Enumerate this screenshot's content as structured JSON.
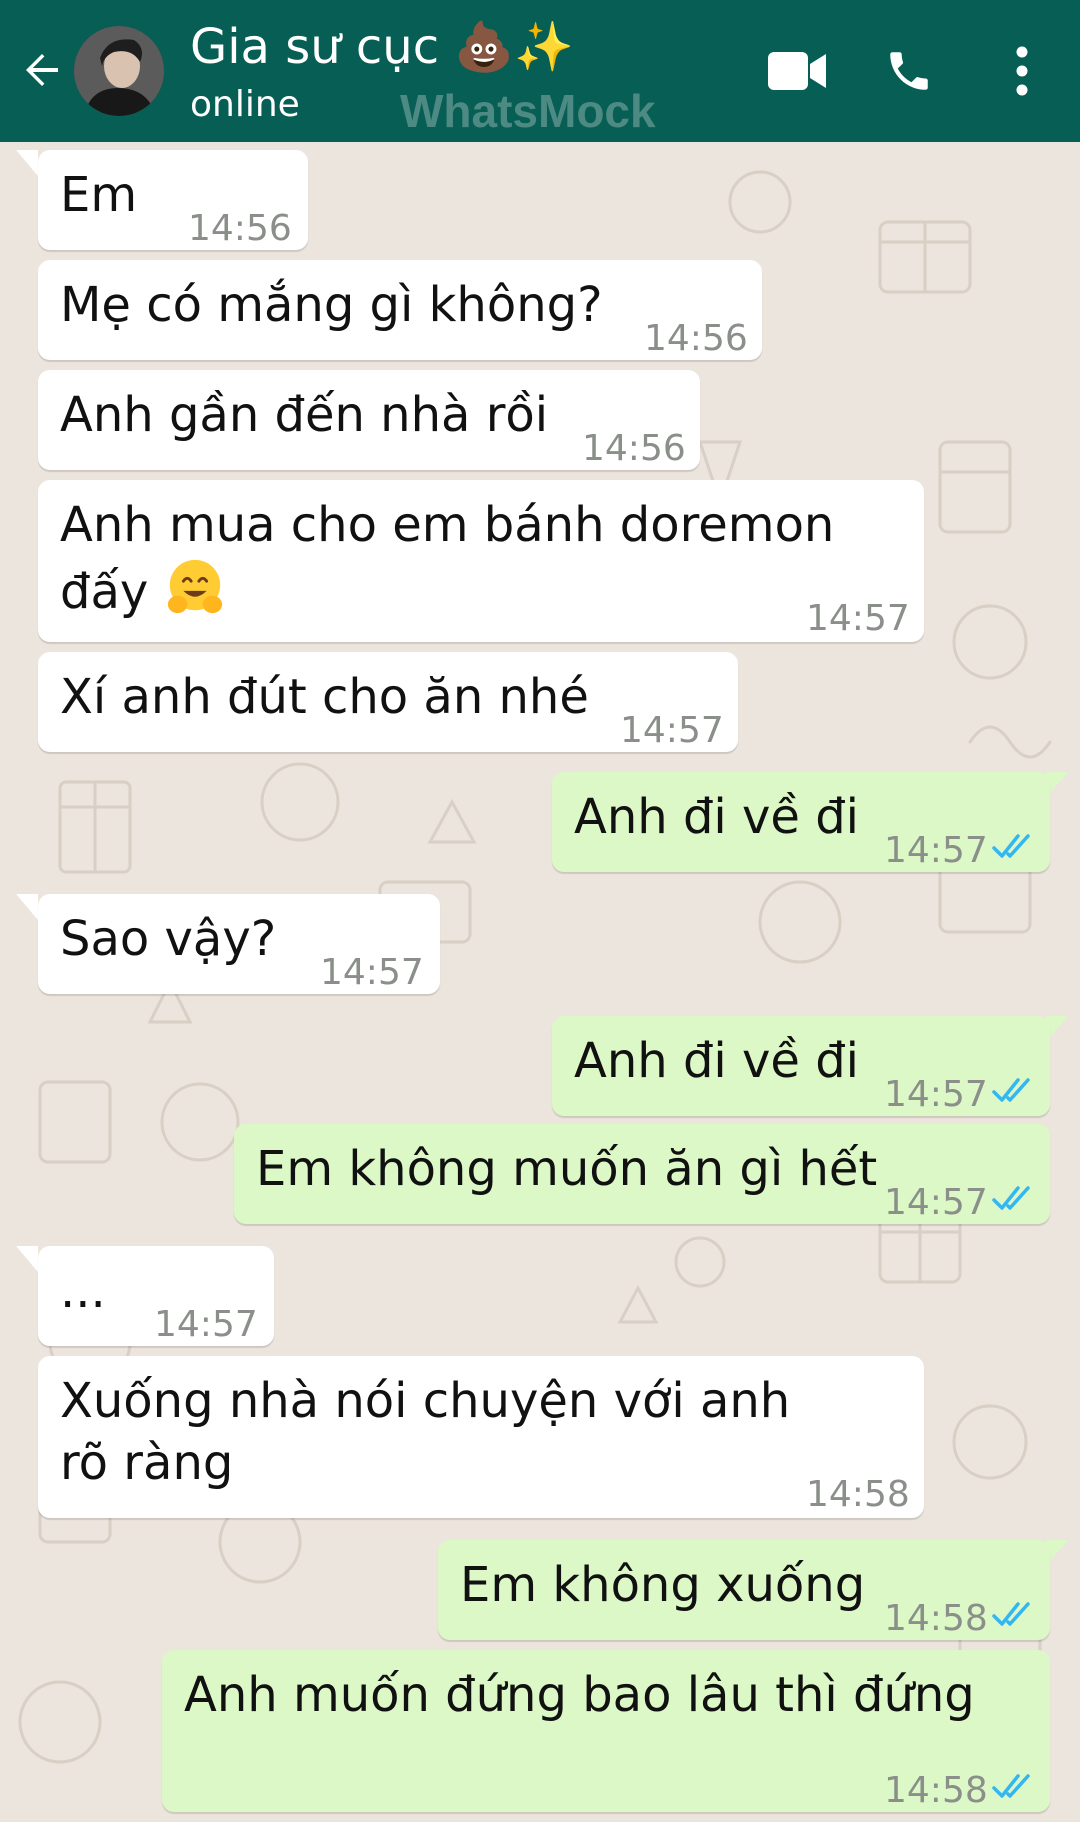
{
  "header": {
    "contact_name": "Gia sư cục 💩✨",
    "status": "online",
    "watermark": "WhatsMock"
  },
  "colors": {
    "header_bg": "#075e54",
    "chat_bg": "#ece5dd",
    "incoming_bubble": "#ffffff",
    "outgoing_bubble": "#dcf8c6",
    "read_tick": "#34b7f1"
  },
  "icons": {
    "back": "arrow-left-icon",
    "video": "video-camera-icon",
    "call": "phone-icon",
    "menu": "more-vertical-icon",
    "read": "double-check-icon"
  },
  "messages": [
    {
      "dir": "in",
      "text": "Em",
      "time": "14:56"
    },
    {
      "dir": "in",
      "text": "Mẹ có mắng gì không?",
      "time": "14:56"
    },
    {
      "dir": "in",
      "text": "Anh gần đến nhà rồi",
      "time": "14:56"
    },
    {
      "dir": "in",
      "text": "Anh mua cho em bánh doremon đấy",
      "time": "14:57",
      "emoji": "hugging-face-emoji"
    },
    {
      "dir": "in",
      "text": "Xí anh đút cho ăn nhé",
      "time": "14:57"
    },
    {
      "dir": "out",
      "text": "Anh đi về đi",
      "time": "14:57",
      "read": true
    },
    {
      "dir": "in",
      "text": "Sao vậy?",
      "time": "14:57"
    },
    {
      "dir": "out",
      "text": "Anh đi về đi",
      "time": "14:57",
      "read": true
    },
    {
      "dir": "out",
      "text": "Em không muốn ăn gì hết",
      "time": "14:57",
      "read": true
    },
    {
      "dir": "in",
      "text": "...",
      "time": "14:57"
    },
    {
      "dir": "in",
      "text": "Xuống nhà nói chuyện với anh rõ ràng",
      "time": "14:58"
    },
    {
      "dir": "out",
      "text": "Em không xuống",
      "time": "14:58",
      "read": true
    },
    {
      "dir": "out",
      "text": "Anh muốn đứng bao lâu thì đứng",
      "time": "14:58",
      "read": true
    }
  ]
}
